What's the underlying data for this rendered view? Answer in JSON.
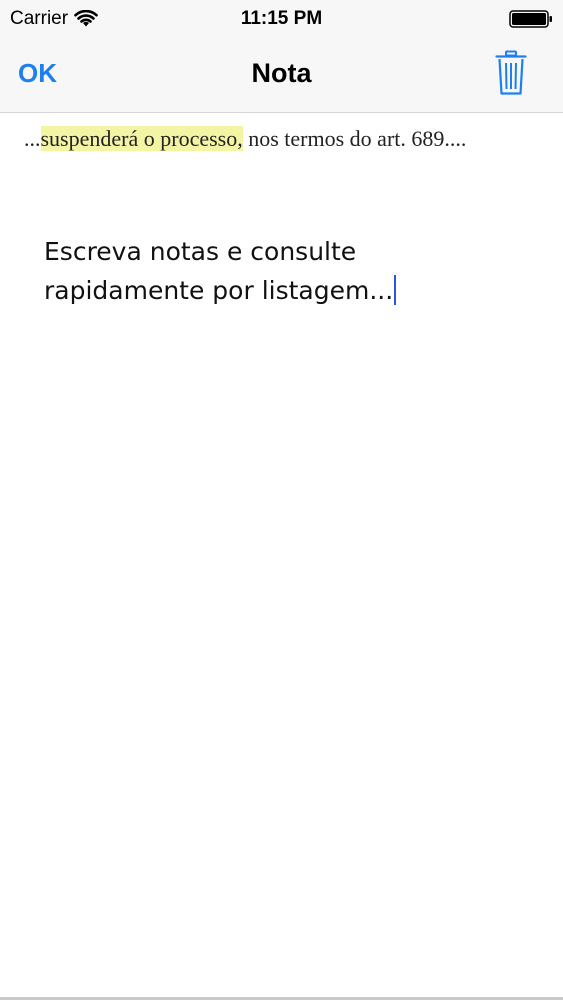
{
  "status_bar": {
    "carrier": "Carrier",
    "time": "11:15 PM",
    "icons": [
      "wifi-icon",
      "battery-icon"
    ]
  },
  "nav": {
    "ok_label": "OK",
    "title": "Nota",
    "trash_icon": "trash-icon",
    "accent_color": "#1e7ff0"
  },
  "quote": {
    "prefix": "...",
    "highlight": "suspenderá o processo,",
    "rest": " nos termos do art. 689....",
    "highlight_color": "#f3f5a4"
  },
  "note": {
    "text": "Escreva notas e consulte rapidamente por listagem..."
  }
}
